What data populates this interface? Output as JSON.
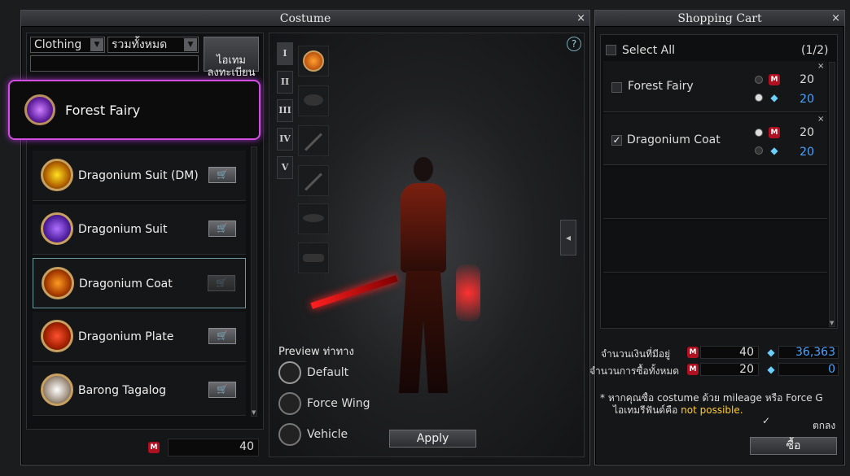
{
  "costume": {
    "title": "Costume",
    "close": "×",
    "filter_type": "Clothing",
    "filter_category": "รวมทั้งหมด",
    "search_value": "",
    "register_button": "ไอเทม\nลงทะเบียน",
    "selected_item": "Forest Fairy",
    "items": [
      {
        "name": "Dragonium Suit (DM)"
      },
      {
        "name": "Dragonium Suit"
      },
      {
        "name": "Dragonium Coat"
      },
      {
        "name": "Dragonium Plate"
      },
      {
        "name": "Barong Tagalog"
      }
    ],
    "mileage_value": "40",
    "tabs": [
      "I",
      "II",
      "III",
      "IV",
      "V"
    ],
    "help": "?",
    "preview_label": "Preview ท่าทาง",
    "poses": [
      "Default",
      "Force Wing",
      "Vehicle"
    ],
    "apply_button": "Apply",
    "side_arrow": "◂"
  },
  "cart": {
    "title": "Shopping Cart",
    "close": "×",
    "select_all": "Select All",
    "page": "(1/2)",
    "entries": [
      {
        "name": "Forest Fairy",
        "checked": false,
        "mileage": "20",
        "force": "20"
      },
      {
        "name": "Dragonium Coat",
        "checked": true,
        "mileage": "20",
        "force": "20"
      }
    ],
    "money_label": "จำนวนเงินที่มีอยู่",
    "money_mileage": "40",
    "money_force": "36,363",
    "total_label": "จำนวนการซื้อทั้งหมด",
    "total_mileage": "20",
    "total_force": "0",
    "note_line1": "* หากคุณซื้อ costume ด้วย mileage หรือ Force G",
    "note_line2_prefix": "ไอเทมรีฟันด์คือ",
    "note_line2_highlight": "not possible.",
    "agree_label": "ตกลง",
    "buy_button": "ซื้อ"
  },
  "colors": {
    "highlight_border": "#d04ee0",
    "force_blue": "#4aa3ff",
    "note_yellow": "#ffcc33"
  }
}
